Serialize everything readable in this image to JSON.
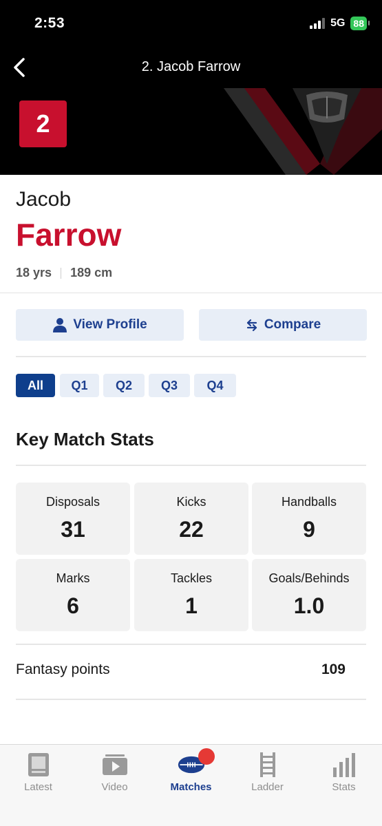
{
  "status": {
    "time": "2:53",
    "network": "5G",
    "battery": "88"
  },
  "header": {
    "title": "2. Jacob Farrow",
    "jersey_number": "2"
  },
  "player": {
    "first_name": "Jacob",
    "last_name": "Farrow",
    "age": "18 yrs",
    "height": "189 cm"
  },
  "actions": {
    "view_profile": "View Profile",
    "compare": "Compare"
  },
  "tabs": [
    {
      "label": "All",
      "active": true
    },
    {
      "label": "Q1",
      "active": false
    },
    {
      "label": "Q2",
      "active": false
    },
    {
      "label": "Q3",
      "active": false
    },
    {
      "label": "Q4",
      "active": false
    }
  ],
  "key_stats": {
    "title": "Key Match Stats",
    "items": [
      {
        "label": "Disposals",
        "value": "31"
      },
      {
        "label": "Kicks",
        "value": "22"
      },
      {
        "label": "Handballs",
        "value": "9"
      },
      {
        "label": "Marks",
        "value": "6"
      },
      {
        "label": "Tackles",
        "value": "1"
      },
      {
        "label": "Goals/Behinds",
        "value": "1.0"
      }
    ]
  },
  "fantasy": {
    "label": "Fantasy points",
    "value": "109"
  },
  "bottom_nav": {
    "items": [
      {
        "label": "Latest",
        "icon": "latest-icon"
      },
      {
        "label": "Video",
        "icon": "video-icon"
      },
      {
        "label": "Matches",
        "icon": "football-icon",
        "active": true
      },
      {
        "label": "Ladder",
        "icon": "ladder-icon"
      },
      {
        "label": "Stats",
        "icon": "stats-icon"
      }
    ]
  },
  "colors": {
    "accent_red": "#c8102e",
    "accent_blue": "#1d3f8f",
    "tab_active": "#0f3f8c"
  }
}
